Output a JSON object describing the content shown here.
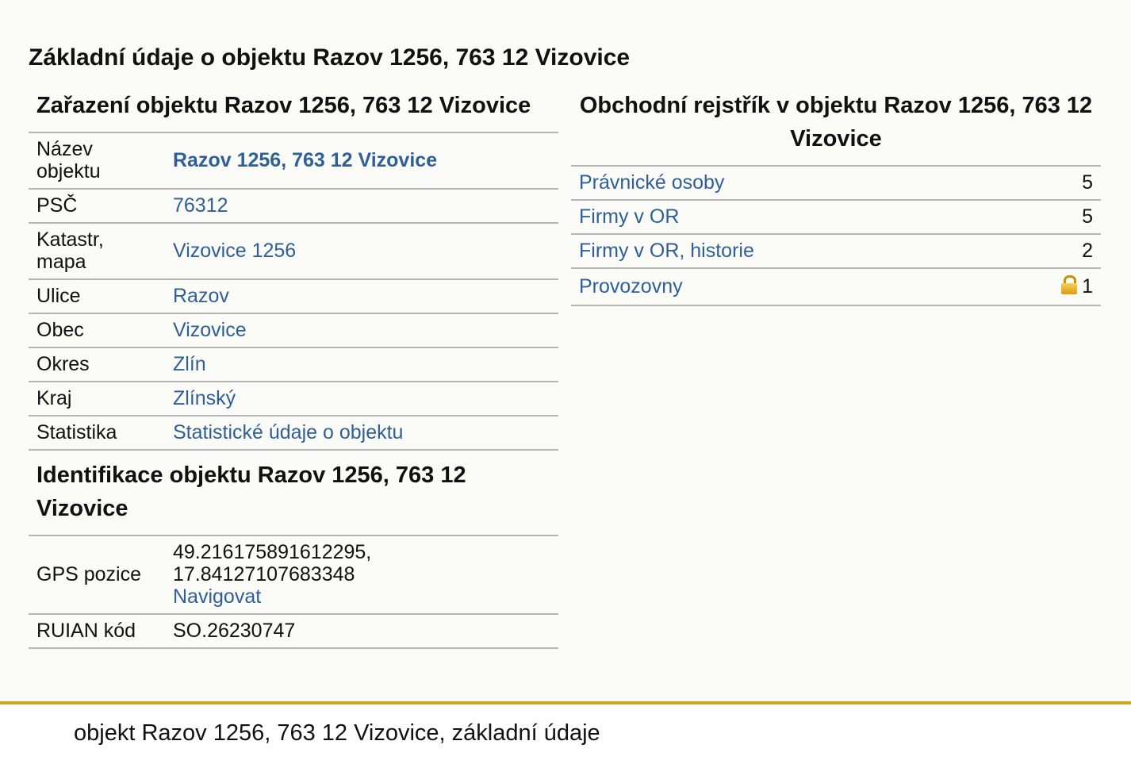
{
  "page_title": "Základní údaje o objektu Razov 1256, 763 12 Vizovice",
  "classification": {
    "title": "Zařazení objektu Razov 1256, 763 12 Vizovice",
    "rows": [
      {
        "key": "Název objektu",
        "value": "Razov 1256, 763 12 Vizovice"
      },
      {
        "key": "PSČ",
        "value": "76312"
      },
      {
        "key": "Katastr, mapa",
        "value": "Vizovice 1256"
      },
      {
        "key": "Ulice",
        "value": "Razov"
      },
      {
        "key": "Obec",
        "value": "Vizovice"
      },
      {
        "key": "Okres",
        "value": "Zlín"
      },
      {
        "key": "Kraj",
        "value": "Zlínský"
      },
      {
        "key": "Statistika",
        "value": "Statistické údaje o objektu"
      }
    ]
  },
  "identification": {
    "title": "Identifikace objektu Razov 1256, 763 12 Vizovice",
    "gps_key": "GPS pozice",
    "gps_lat": "49.216175891612295,",
    "gps_lon": "17.84127107683348",
    "navigate_label": "Navigovat",
    "ruian_key": "RUIAN kód",
    "ruian_value": "SO.26230747"
  },
  "commercial_register": {
    "title": "Obchodní rejstřík v objektu Razov 1256, 763 12 Vizovice",
    "rows": [
      {
        "label": "Právnické osoby",
        "count": "5"
      },
      {
        "label": "Firmy v OR",
        "count": "5"
      },
      {
        "label": "Firmy v OR, historie",
        "count": "2"
      },
      {
        "label": "Provozovny",
        "count": "1",
        "icon": "lock-icon"
      }
    ]
  },
  "footer": "objekt Razov 1256, 763 12 Vizovice, základní údaje",
  "colors": {
    "link": "#2f5f97",
    "footer_accent": "#d4a41c"
  }
}
